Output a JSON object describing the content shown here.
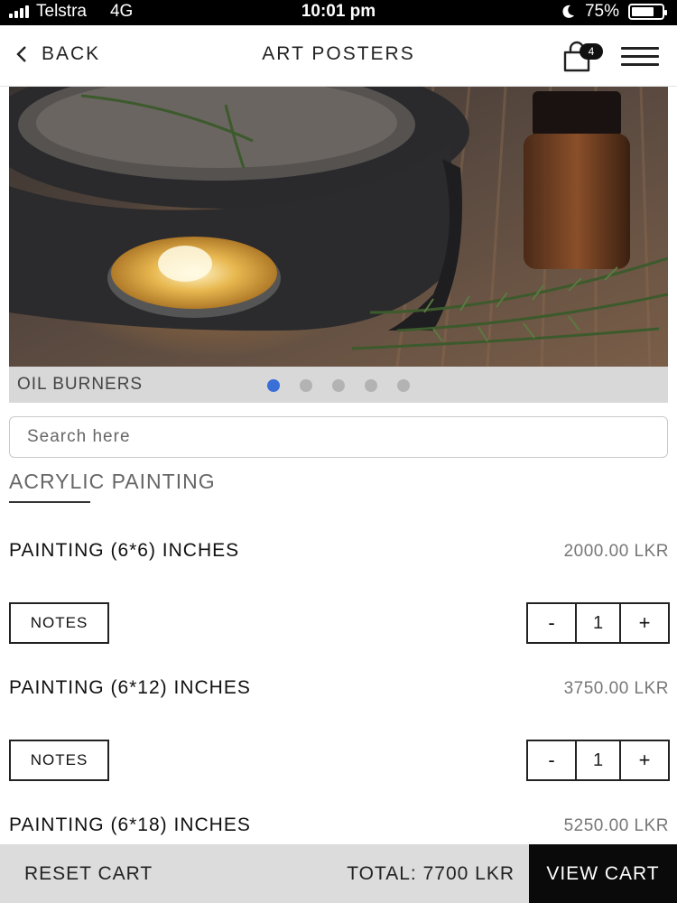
{
  "status_bar": {
    "carrier": "Telstra",
    "network": "4G",
    "time": "10:01 pm",
    "battery_percent": "75%",
    "battery_level": 0.75
  },
  "nav": {
    "back_label": "BACK",
    "title": "ART POSTERS",
    "cart_count": "4"
  },
  "banner": {
    "caption": "OIL BURNERS",
    "slide_count": 5,
    "active_slide": 0
  },
  "search": {
    "placeholder": "Search here",
    "value": ""
  },
  "category": {
    "title": "ACRYLIC PAINTING"
  },
  "products": [
    {
      "name": "PAINTING (6*6) INCHES",
      "price": "2000.00 LKR",
      "notes_label": "NOTES",
      "minus": "-",
      "qty": "1",
      "plus": "+"
    },
    {
      "name": "PAINTING (6*12) INCHES",
      "price": "3750.00 LKR",
      "notes_label": "NOTES",
      "minus": "-",
      "qty": "1",
      "plus": "+"
    },
    {
      "name": "PAINTING (6*18) INCHES",
      "price": "5250.00 LKR"
    }
  ],
  "footer": {
    "reset_label": "RESET CART",
    "total_label": "TOTAL: 7700 LKR",
    "view_cart_label": "VIEW CART"
  },
  "colors": {
    "accent_dot": "#3a6fd8",
    "bottom_bar": "#dcdcdc",
    "view_cart_bg": "#0a0a0a"
  }
}
